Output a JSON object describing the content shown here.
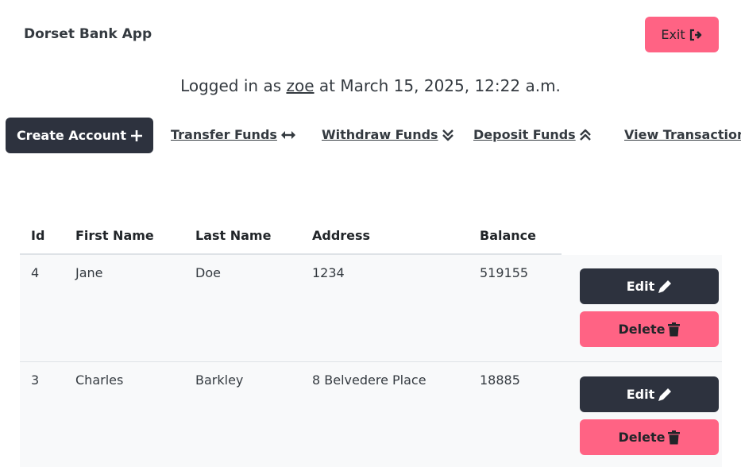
{
  "app": {
    "title": "Dorset Bank App",
    "exit_label": "Exit"
  },
  "login": {
    "prefix": "Logged in as",
    "user": "zoe",
    "middle": "at",
    "timestamp": "March 15, 2025, 12:22 a.m."
  },
  "nav": {
    "create_account": "Create Account",
    "transfer": "Transfer Funds",
    "withdraw": "Withdraw Funds",
    "deposit": "Deposit Funds",
    "view_transactions": "View Transactions"
  },
  "table": {
    "headers": [
      "Id",
      "First Name",
      "Last Name",
      "Address",
      "Balance"
    ],
    "rows": [
      {
        "id": "4",
        "first_name": "Jane",
        "last_name": "Doe",
        "address": "1234",
        "balance": "519155"
      },
      {
        "id": "3",
        "first_name": "Charles",
        "last_name": "Barkley",
        "address": "8 Belvedere Place",
        "balance": "18885"
      }
    ],
    "edit_label": "Edit",
    "delete_label": "Delete"
  },
  "colors": {
    "dark": "#2d323e",
    "accent_pink": "#ff6384",
    "row_bg": "#f8f9fa"
  },
  "icons": {
    "exit": "sign-out-icon",
    "create": "plus-icon",
    "transfer": "arrows-left-right-icon",
    "withdraw": "double-chevron-down-icon",
    "deposit": "double-chevron-up-icon",
    "edit": "pencil-icon",
    "delete": "trash-icon"
  }
}
